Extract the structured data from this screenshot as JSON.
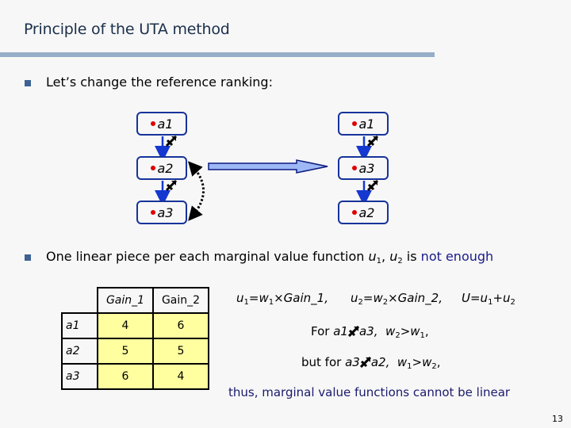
{
  "slide": {
    "title": "Principle of the UTA method",
    "page_number": "13"
  },
  "bullets": [
    {
      "text": "Let’s change the reference ranking:"
    },
    {
      "text_prefix": "One linear piece per each marginal value function ",
      "var_u": "u",
      "sub1": "1",
      "sep": ", ",
      "sub2": "2",
      "is": " is ",
      "emphasis": "not enough"
    }
  ],
  "ranking_diagram": {
    "before": [
      "a1",
      "a2",
      "a3"
    ],
    "after": [
      "a1",
      "a3",
      "a2"
    ],
    "preference_icon": "outranking-arrow-icon",
    "swap_icon": "dotted-double-arrow-icon",
    "transform_icon": "right-arrow-icon",
    "colors": {
      "node_border": "#17339a",
      "node_dot": "#dd0000",
      "transform_arrow_fill": "#9db8f5",
      "transform_arrow_stroke": "#0d1a80"
    }
  },
  "table": {
    "columns": [
      "Gain_1",
      "Gain_2"
    ],
    "rows": [
      {
        "label": "a1",
        "values": [
          "4",
          "6"
        ]
      },
      {
        "label": "a2",
        "values": [
          "5",
          "5"
        ]
      },
      {
        "label": "a3",
        "values": [
          "6",
          "4"
        ]
      }
    ],
    "cell_color": "#ffff9f"
  },
  "formulas": {
    "u1": {
      "lhs": "u",
      "lhs_sub": "1",
      "eq": "=w",
      "w_sub": "1",
      "times": "×Gain_1,"
    },
    "u2": {
      "lhs": "u",
      "lhs_sub": "2",
      "eq": "=w",
      "w_sub": "2",
      "times": "×Gain_2,"
    },
    "U": {
      "lhs": "U=u",
      "sub1": "1",
      "plus": "+u",
      "sub2": "2"
    }
  },
  "reasoning": {
    "line1": {
      "prefix": "For ",
      "left": "a1",
      "right": "a3,",
      "cond_w": "w",
      "cond_sub_a": "2",
      "gt": ">w",
      "cond_sub_b": "1",
      "tail": ","
    },
    "line2": {
      "prefix": "but for ",
      "left": "a3",
      "right": "a2,",
      "cond_w": "w",
      "cond_sub_a": "1",
      "gt": ">w",
      "cond_sub_b": "2",
      "tail": ","
    },
    "conclusion": "thus, marginal value functions cannot be linear"
  }
}
